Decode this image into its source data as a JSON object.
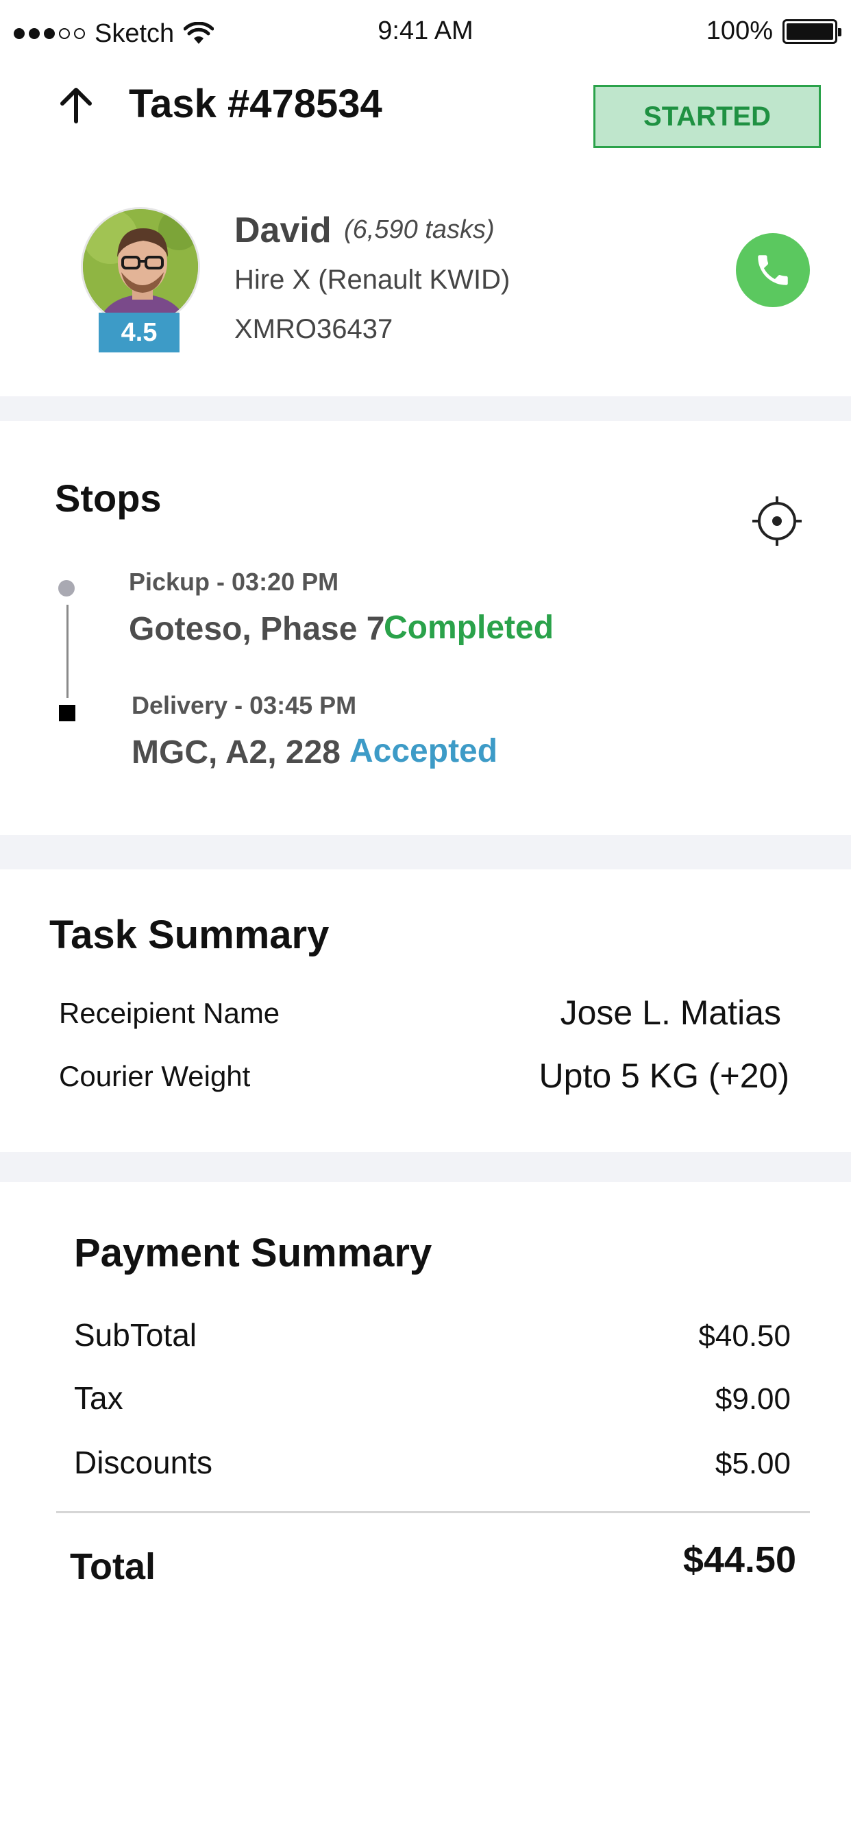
{
  "status_bar": {
    "carrier": "Sketch",
    "time": "9:41 AM",
    "battery": "100%"
  },
  "header": {
    "title": "Task #478534",
    "status": "STARTED"
  },
  "driver": {
    "name": "David",
    "tasks": "(6,590 tasks)",
    "vehicle": "Hire X (Renault KWID)",
    "id": "XMRO36437",
    "rating": "4.5"
  },
  "stops": {
    "title": "Stops",
    "items": [
      {
        "meta": "Pickup - 03:20 PM",
        "address": "Goteso, Phase 7",
        "status": "Completed",
        "status_color": "#2aa24a"
      },
      {
        "meta": "Delivery - 03:45 PM",
        "address": "MGC, A2, 228",
        "status": "Accepted",
        "status_color": "#3d9bc7"
      }
    ]
  },
  "task_summary": {
    "title": "Task Summary",
    "rows": [
      {
        "label": "Receipient Name",
        "value": "Jose L. Matias"
      },
      {
        "label": "Courier Weight",
        "value": "Upto 5 KG (+20)"
      }
    ]
  },
  "payment_summary": {
    "title": "Payment Summary",
    "rows": [
      {
        "label": "SubTotal",
        "value": "$40.50"
      },
      {
        "label": "Tax",
        "value": "$9.00"
      },
      {
        "label": "Discounts",
        "value": "$5.00"
      }
    ],
    "total_label": "Total",
    "total_value": "$44.50"
  },
  "colors": {
    "accent_green": "#5bc85f",
    "status_green": "#2aa24a",
    "accent_blue": "#3d9bc7",
    "band": "#f2f3f7"
  }
}
